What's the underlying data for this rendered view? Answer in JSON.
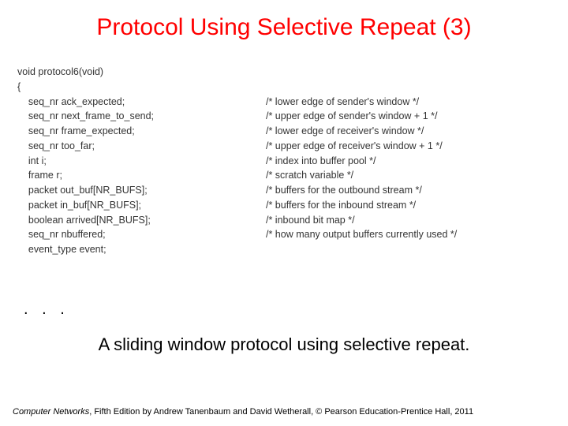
{
  "title": "Protocol Using Selective Repeat (3)",
  "code": {
    "line0": "void protocol6(void)",
    "line1": "{",
    "decl0": "    seq_nr ack_expected;",
    "decl1": "    seq_nr next_frame_to_send;",
    "decl2": "    seq_nr frame_expected;",
    "decl3": "    seq_nr too_far;",
    "decl4": "    int i;",
    "decl5": "    frame r;",
    "decl6": "    packet out_buf[NR_BUFS];",
    "decl7": "    packet in_buf[NR_BUFS];",
    "decl8": "    boolean arrived[NR_BUFS];",
    "decl9": "    seq_nr nbuffered;",
    "decl10": "    event_type event;",
    "cmt0": "/* lower edge of sender's window */",
    "cmt1": "/* upper edge of sender's window + 1 */",
    "cmt2": "/* lower edge of receiver's window */",
    "cmt3": "/* upper edge of receiver's window + 1 */",
    "cmt4": "/* index into buffer pool */",
    "cmt5": "/* scratch variable */",
    "cmt6": "/* buffers for the outbound stream */",
    "cmt7": "/* buffers for the inbound stream */",
    "cmt8": "/* inbound bit map */",
    "cmt9": "/* how many output buffers currently used */"
  },
  "ellipsis": ". . .",
  "caption": "A sliding window protocol using selective repeat.",
  "footer_italic": "Computer Networks",
  "footer_rest": ", Fifth Edition by Andrew Tanenbaum and David Wetherall, © Pearson Education-Prentice Hall, 2011"
}
